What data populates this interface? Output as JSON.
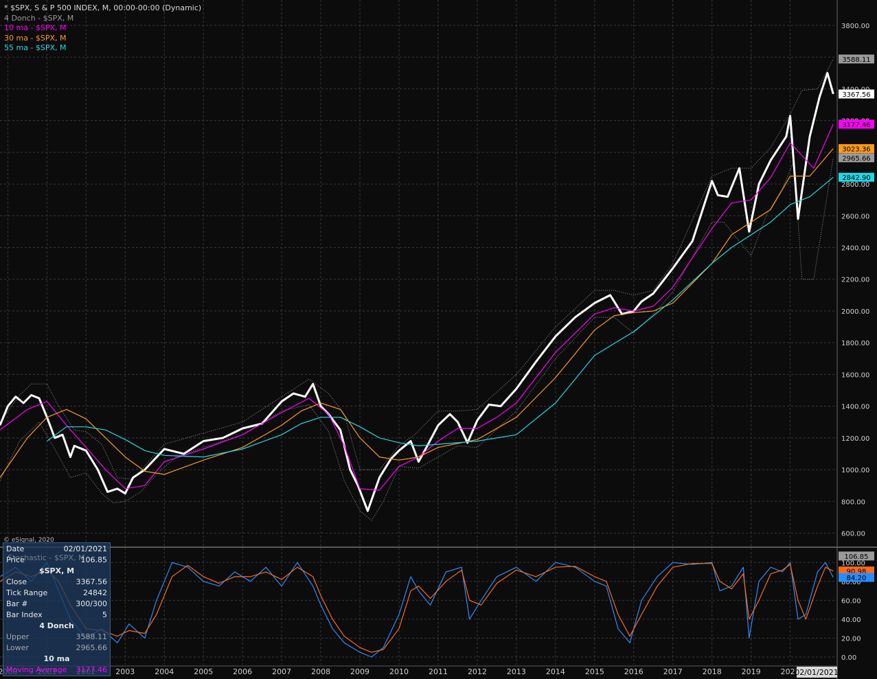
{
  "legend": {
    "title": "* $SPX, S & P 500 INDEX, M, 00:00-00:00 (Dynamic)",
    "donch": "4 Donch - $SPX, M",
    "ma10": "10 ma - $SPX, M",
    "ma30": "30 ma - $SPX, M",
    "ma55": "55 ma - $SPX, M"
  },
  "copyright": "© eSignal, 2020",
  "info": {
    "date_label": "Date",
    "date_value": "02/01/2021",
    "price_label": "Price",
    "price_value": "106.85",
    "symbol": "$SPX, M",
    "close_label": "Close",
    "close_value": "3367.56",
    "tick_label": "Tick Range",
    "tick_value": "24842",
    "bar_label": "Bar #",
    "bar_value": "300/300",
    "barindex_label": "Bar Index",
    "barindex_value": "5",
    "donch_header": "4 Donch",
    "upper_label": "Upper",
    "upper_value": "3588.11",
    "lower_label": "Lower",
    "lower_value": "2965.66",
    "ma_header": "10 ma",
    "ma_label": "Moving Average",
    "ma_value": "3177.46",
    "stoch_overlay": "Stochastic - $SPX, M"
  },
  "colors": {
    "price": "#ffffff",
    "ma10": "#ff00ff",
    "ma30": "#ff9a1a",
    "ma55": "#22d8e6",
    "donch": "#9a9a9a",
    "stoch_k": "#2a8cff",
    "stoch_d": "#ff6a1a",
    "grid": "#3a3a3a",
    "axis_text": "#d0d0d0"
  },
  "chart_data": [
    {
      "type": "line",
      "title": "* $SPX, S & P 500 INDEX, M, 00:00-00:00 (Dynamic)",
      "xlabel": "",
      "ylabel": "",
      "x_range": [
        1999.8,
        2021.2
      ],
      "ylim": [
        520,
        3960
      ],
      "yticks": [
        600,
        800,
        1000,
        1200,
        1400,
        1600,
        1800,
        2000,
        2200,
        2400,
        2600,
        2800,
        3000,
        3200,
        3400,
        3600,
        3800
      ],
      "ytick_labels": [
        "600.00",
        "800.00",
        "1000.00",
        "1200.00",
        "1400.00",
        "1600.00",
        "1800.00",
        "2000.00",
        "2200.00",
        "2400.00",
        "2600.00",
        "2800.00",
        "3000.00",
        "3200.00",
        "3400.00",
        "3600.00",
        "3800.00"
      ],
      "xticks": [
        2000,
        2001,
        2002,
        2003,
        2004,
        2005,
        2006,
        2007,
        2008,
        2009,
        2010,
        2011,
        2012,
        2013,
        2014,
        2015,
        2016,
        2017,
        2018,
        2019,
        2020
      ],
      "xtick_labels": [
        "2000",
        "2001",
        "2002",
        "2003",
        "2004",
        "2005",
        "2006",
        "2007",
        "2008",
        "2009",
        "2010",
        "2011",
        "2012",
        "2013",
        "2014",
        "2015",
        "2016",
        "2017",
        "2018",
        "2019",
        "2020"
      ],
      "current_date_label": "02/01/2021",
      "grid": true,
      "price_tags": [
        {
          "label": "3588.11",
          "value": 3588.11,
          "color": "#9a9a9a",
          "text": "#000000"
        },
        {
          "label": "3367.56",
          "value": 3367.56,
          "color": "#ffffff",
          "text": "#000000"
        },
        {
          "label": "3177.46",
          "value": 3177.46,
          "color": "#ff00ff",
          "text": "#000000"
        },
        {
          "label": "3023.36",
          "value": 3023.36,
          "color": "#ff9a1a",
          "text": "#000000"
        },
        {
          "label": "2965.66",
          "value": 2965.66,
          "color": "#9a9a9a",
          "text": "#000000"
        },
        {
          "label": "2842.90",
          "value": 2842.9,
          "color": "#22d8e6",
          "text": "#000000"
        }
      ],
      "series": [
        {
          "name": "$SPX",
          "color": "#ffffff",
          "x": [
            1999.8,
            2000.0,
            2000.2,
            2000.4,
            2000.6,
            2000.8,
            2001.0,
            2001.2,
            2001.4,
            2001.6,
            2001.7,
            2002.0,
            2002.3,
            2002.55,
            2002.8,
            2003.0,
            2003.2,
            2003.5,
            2004.0,
            2004.5,
            2005.0,
            2005.5,
            2006.0,
            2006.5,
            2007.0,
            2007.3,
            2007.6,
            2007.8,
            2008.0,
            2008.2,
            2008.5,
            2008.75,
            2008.95,
            2009.2,
            2009.5,
            2009.8,
            2010.0,
            2010.3,
            2010.5,
            2010.7,
            2011.0,
            2011.3,
            2011.5,
            2011.75,
            2012.0,
            2012.3,
            2012.6,
            2013.0,
            2013.5,
            2014.0,
            2014.5,
            2015.0,
            2015.4,
            2015.7,
            2016.0,
            2016.2,
            2016.5,
            2017.0,
            2017.5,
            2018.0,
            2018.15,
            2018.4,
            2018.7,
            2018.95,
            2019.2,
            2019.5,
            2019.9,
            2020.0,
            2020.2,
            2020.5,
            2020.75,
            2020.95,
            2021.1
          ],
          "y": [
            1280,
            1400,
            1460,
            1420,
            1470,
            1450,
            1330,
            1200,
            1220,
            1080,
            1150,
            1120,
            1000,
            860,
            880,
            850,
            950,
            1000,
            1130,
            1100,
            1180,
            1200,
            1260,
            1290,
            1430,
            1480,
            1460,
            1540,
            1400,
            1350,
            1250,
            1000,
            900,
            740,
            950,
            1070,
            1120,
            1180,
            1050,
            1140,
            1280,
            1350,
            1300,
            1170,
            1310,
            1410,
            1400,
            1510,
            1680,
            1840,
            1960,
            2050,
            2100,
            1980,
            2000,
            2060,
            2110,
            2270,
            2440,
            2820,
            2730,
            2720,
            2900,
            2500,
            2800,
            2950,
            3100,
            3230,
            2580,
            3100,
            3350,
            3500,
            3367.56
          ]
        },
        {
          "name": "10 ma",
          "color": "#ff00ff",
          "x": [
            1999.8,
            2000.5,
            2001.0,
            2001.5,
            2002.0,
            2002.5,
            2003.0,
            2003.5,
            2004.0,
            2005.0,
            2006.0,
            2007.0,
            2007.7,
            2008.2,
            2008.6,
            2009.0,
            2009.5,
            2010.0,
            2010.5,
            2011.0,
            2011.5,
            2012.0,
            2012.5,
            2013.0,
            2014.0,
            2015.0,
            2015.5,
            2016.0,
            2016.5,
            2017.0,
            2018.0,
            2018.5,
            2019.0,
            2019.5,
            2020.0,
            2020.3,
            2020.6,
            2021.1
          ],
          "y": [
            1250,
            1380,
            1430,
            1280,
            1140,
            1000,
            880,
            900,
            1050,
            1130,
            1220,
            1360,
            1450,
            1350,
            1150,
            880,
            870,
            1020,
            1080,
            1180,
            1260,
            1260,
            1330,
            1420,
            1740,
            1980,
            2020,
            2000,
            2030,
            2150,
            2520,
            2680,
            2700,
            2840,
            3060,
            2980,
            2900,
            3177.46
          ]
        },
        {
          "name": "30 ma",
          "color": "#ff9a1a",
          "x": [
            1999.8,
            2000.5,
            2001.0,
            2001.5,
            2002.0,
            2002.5,
            2003.0,
            2003.5,
            2004.0,
            2005.0,
            2006.0,
            2007.0,
            2007.5,
            2008.0,
            2008.5,
            2009.0,
            2009.5,
            2010.0,
            2010.5,
            2011.0,
            2012.0,
            2013.0,
            2014.0,
            2015.0,
            2015.5,
            2016.0,
            2016.5,
            2017.0,
            2018.0,
            2018.5,
            2019.0,
            2019.5,
            2020.0,
            2020.5,
            2021.1
          ],
          "y": [
            950,
            1200,
            1330,
            1380,
            1320,
            1200,
            1080,
            990,
            970,
            1060,
            1140,
            1280,
            1370,
            1420,
            1380,
            1200,
            1080,
            1060,
            1080,
            1140,
            1190,
            1330,
            1580,
            1880,
            1970,
            1990,
            2000,
            2050,
            2300,
            2480,
            2560,
            2640,
            2850,
            2850,
            3023.36
          ]
        },
        {
          "name": "55 ma",
          "color": "#22d8e6",
          "x": [
            2001.0,
            2001.5,
            2002.0,
            2002.5,
            2003.0,
            2003.5,
            2004.0,
            2005.0,
            2006.0,
            2007.0,
            2007.5,
            2008.0,
            2008.5,
            2009.0,
            2009.5,
            2010.0,
            2010.5,
            2011.0,
            2012.0,
            2013.0,
            2014.0,
            2015.0,
            2016.0,
            2017.0,
            2018.0,
            2018.5,
            2019.0,
            2019.5,
            2020.0,
            2020.5,
            2021.1
          ],
          "y": [
            1180,
            1270,
            1270,
            1250,
            1190,
            1120,
            1090,
            1080,
            1130,
            1220,
            1290,
            1330,
            1330,
            1270,
            1200,
            1170,
            1150,
            1160,
            1180,
            1220,
            1420,
            1720,
            1870,
            2070,
            2300,
            2400,
            2480,
            2560,
            2670,
            2720,
            2842.9
          ]
        },
        {
          "name": "4 Donch Upper",
          "color": "#9a9a9a",
          "x": [
            1999.8,
            2000.3,
            2000.6,
            2001.0,
            2001.3,
            2001.7,
            2002.0,
            2002.4,
            2002.8,
            2003.2,
            2003.6,
            2004.0,
            2005.0,
            2006.0,
            2007.0,
            2007.7,
            2008.2,
            2008.6,
            2009.0,
            2009.5,
            2010.0,
            2010.4,
            2011.0,
            2011.5,
            2012.0,
            2013.0,
            2014.0,
            2015.0,
            2015.5,
            2016.0,
            2016.5,
            2017.0,
            2018.0,
            2018.5,
            2019.0,
            2019.5,
            2020.0,
            2020.3,
            2020.7,
            2021.1
          ],
          "y": [
            1300,
            1470,
            1540,
            1540,
            1400,
            1250,
            1240,
            1160,
            950,
            940,
            1050,
            1160,
            1230,
            1300,
            1460,
            1570,
            1480,
            1350,
            1000,
            1000,
            1150,
            1220,
            1370,
            1370,
            1380,
            1600,
            1900,
            2130,
            2130,
            2100,
            2130,
            2300,
            2850,
            2900,
            2900,
            3030,
            3240,
            3390,
            3400,
            3588.11
          ]
        },
        {
          "name": "4 Donch Lower",
          "color": "#9a9a9a",
          "x": [
            1999.8,
            2000.3,
            2000.8,
            2001.2,
            2001.6,
            2002.0,
            2002.4,
            2002.7,
            2003.0,
            2003.4,
            2003.8,
            2004.3,
            2005.0,
            2006.0,
            2007.0,
            2007.7,
            2008.2,
            2008.6,
            2009.0,
            2009.3,
            2009.6,
            2010.0,
            2010.5,
            2011.0,
            2011.5,
            2012.0,
            2013.0,
            2014.0,
            2015.0,
            2015.5,
            2016.0,
            2016.5,
            2017.0,
            2018.0,
            2018.3,
            2019.0,
            2019.4,
            2019.8,
            2020.1,
            2020.3,
            2020.6,
            2021.1
          ],
          "y": [
            930,
            1180,
            1300,
            1130,
            950,
            980,
            850,
            790,
            800,
            860,
            970,
            1080,
            1140,
            1220,
            1370,
            1410,
            1240,
            930,
            740,
            680,
            800,
            1020,
            1010,
            1080,
            1150,
            1140,
            1370,
            1700,
            1960,
            1960,
            1860,
            1980,
            2120,
            2560,
            2560,
            2350,
            2610,
            2770,
            2950,
            2200,
            2200,
            2965.66
          ]
        }
      ]
    },
    {
      "type": "line",
      "title": "Stochastic - $SPX, M",
      "ylim": [
        -8,
        114
      ],
      "yticks": [
        0,
        20,
        40,
        60,
        80,
        100
      ],
      "ytick_labels": [
        "0.00",
        "20.00",
        "40.00",
        "60.00",
        "80.00",
        "100.00"
      ],
      "price_tags": [
        {
          "label": "106.85",
          "value": 106.85,
          "color": "#9a9a9a",
          "text": "#000000"
        },
        {
          "label": "90.98",
          "value": 90.98,
          "color": "#ff6a1a",
          "text": "#000000"
        },
        {
          "label": "84.20",
          "value": 84.2,
          "color": "#2a8cff",
          "text": "#000000"
        }
      ],
      "series": [
        {
          "name": "%K",
          "color": "#2a8cff",
          "x": [
            1999.8,
            2000.2,
            2000.6,
            2001.0,
            2001.3,
            2001.6,
            2002.0,
            2002.4,
            2002.8,
            2003.1,
            2003.5,
            2003.8,
            2004.2,
            2004.6,
            2005.0,
            2005.4,
            2005.8,
            2006.2,
            2006.6,
            2007.0,
            2007.4,
            2007.8,
            2008.0,
            2008.3,
            2008.6,
            2009.0,
            2009.3,
            2009.6,
            2010.0,
            2010.3,
            2010.5,
            2010.8,
            2011.2,
            2011.6,
            2011.8,
            2012.1,
            2012.5,
            2013.0,
            2013.5,
            2014.0,
            2014.5,
            2015.0,
            2015.3,
            2015.6,
            2015.9,
            2016.2,
            2016.6,
            2017.0,
            2017.5,
            2018.0,
            2018.2,
            2018.5,
            2018.8,
            2018.95,
            2019.2,
            2019.5,
            2019.8,
            2020.0,
            2020.2,
            2020.4,
            2020.7,
            2020.9,
            2021.1
          ],
          "y": [
            85,
            95,
            80,
            100,
            70,
            40,
            20,
            30,
            15,
            35,
            20,
            60,
            100,
            95,
            80,
            75,
            90,
            80,
            95,
            75,
            100,
            75,
            55,
            30,
            15,
            5,
            0,
            10,
            45,
            85,
            70,
            55,
            90,
            95,
            40,
            60,
            85,
            95,
            80,
            100,
            95,
            80,
            75,
            30,
            15,
            60,
            85,
            100,
            98,
            100,
            70,
            75,
            95,
            20,
            80,
            95,
            90,
            100,
            40,
            45,
            90,
            100,
            84.2
          ]
        },
        {
          "name": "%D",
          "color": "#ff6a1a",
          "x": [
            1999.8,
            2000.2,
            2000.6,
            2001.0,
            2001.3,
            2001.6,
            2002.0,
            2002.4,
            2002.8,
            2003.1,
            2003.5,
            2003.8,
            2004.2,
            2004.6,
            2005.0,
            2005.4,
            2005.8,
            2006.2,
            2006.6,
            2007.0,
            2007.4,
            2007.8,
            2008.0,
            2008.3,
            2008.6,
            2009.0,
            2009.3,
            2009.6,
            2010.0,
            2010.3,
            2010.5,
            2010.8,
            2011.2,
            2011.6,
            2011.8,
            2012.1,
            2012.5,
            2013.0,
            2013.5,
            2014.0,
            2014.5,
            2015.0,
            2015.3,
            2015.6,
            2015.9,
            2016.2,
            2016.6,
            2017.0,
            2017.5,
            2018.0,
            2018.2,
            2018.5,
            2018.8,
            2018.95,
            2019.2,
            2019.5,
            2019.8,
            2020.0,
            2020.2,
            2020.4,
            2020.7,
            2020.9,
            2021.1
          ],
          "y": [
            80,
            90,
            85,
            92,
            80,
            55,
            30,
            28,
            22,
            28,
            25,
            45,
            85,
            97,
            85,
            78,
            85,
            85,
            90,
            82,
            95,
            85,
            65,
            40,
            22,
            10,
            5,
            8,
            30,
            70,
            75,
            62,
            80,
            92,
            60,
            55,
            78,
            92,
            85,
            95,
            96,
            85,
            80,
            45,
            22,
            45,
            75,
            95,
            99,
            99,
            80,
            72,
            88,
            40,
            60,
            88,
            92,
            98,
            60,
            40,
            75,
            95,
            90.98
          ]
        }
      ]
    }
  ]
}
